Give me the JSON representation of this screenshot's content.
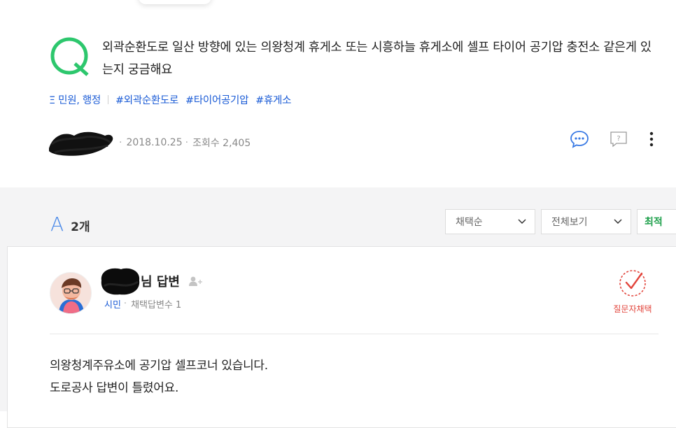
{
  "question": {
    "title": "외곽순환도로 일산 방향에 있는 의왕청계 휴게소 또는 시흥하늘 휴게소에 셀프 타이어 공기압 충전소 같은게 있는지 궁금해요",
    "category": "Ξ 민원, 행정",
    "tags": [
      "#외곽순환도로",
      "#타이어공기압",
      "#휴게소"
    ],
    "date": "2018.10.25",
    "views": "조회수 2,405",
    "actions": {
      "comment_icon": "comment-bubble-icon",
      "report_icon": "question-report-icon",
      "more_icon": "more-vertical-icon"
    }
  },
  "answers": {
    "letter": "A",
    "count": "2개",
    "sort_select": "채택순",
    "filter_select": "전체보기",
    "latest": "최적",
    "items": [
      {
        "name_suffix": "님 답변",
        "grade": "시민",
        "adopted_count": "채택답변수 1",
        "adopt_label": "질문자채택",
        "body": [
          "의왕청계주유소에 공기압 셀프코너 있습니다.",
          "도로공사 답변이 틀렸어요."
        ]
      }
    ]
  },
  "colors": {
    "q_green": "#2dc76d",
    "a_blue": "#4d8be8",
    "link_blue": "#1a5bd6",
    "adopt_red": "#e2453c",
    "latest_green": "#1ea04b"
  },
  "q_letter": "Q"
}
